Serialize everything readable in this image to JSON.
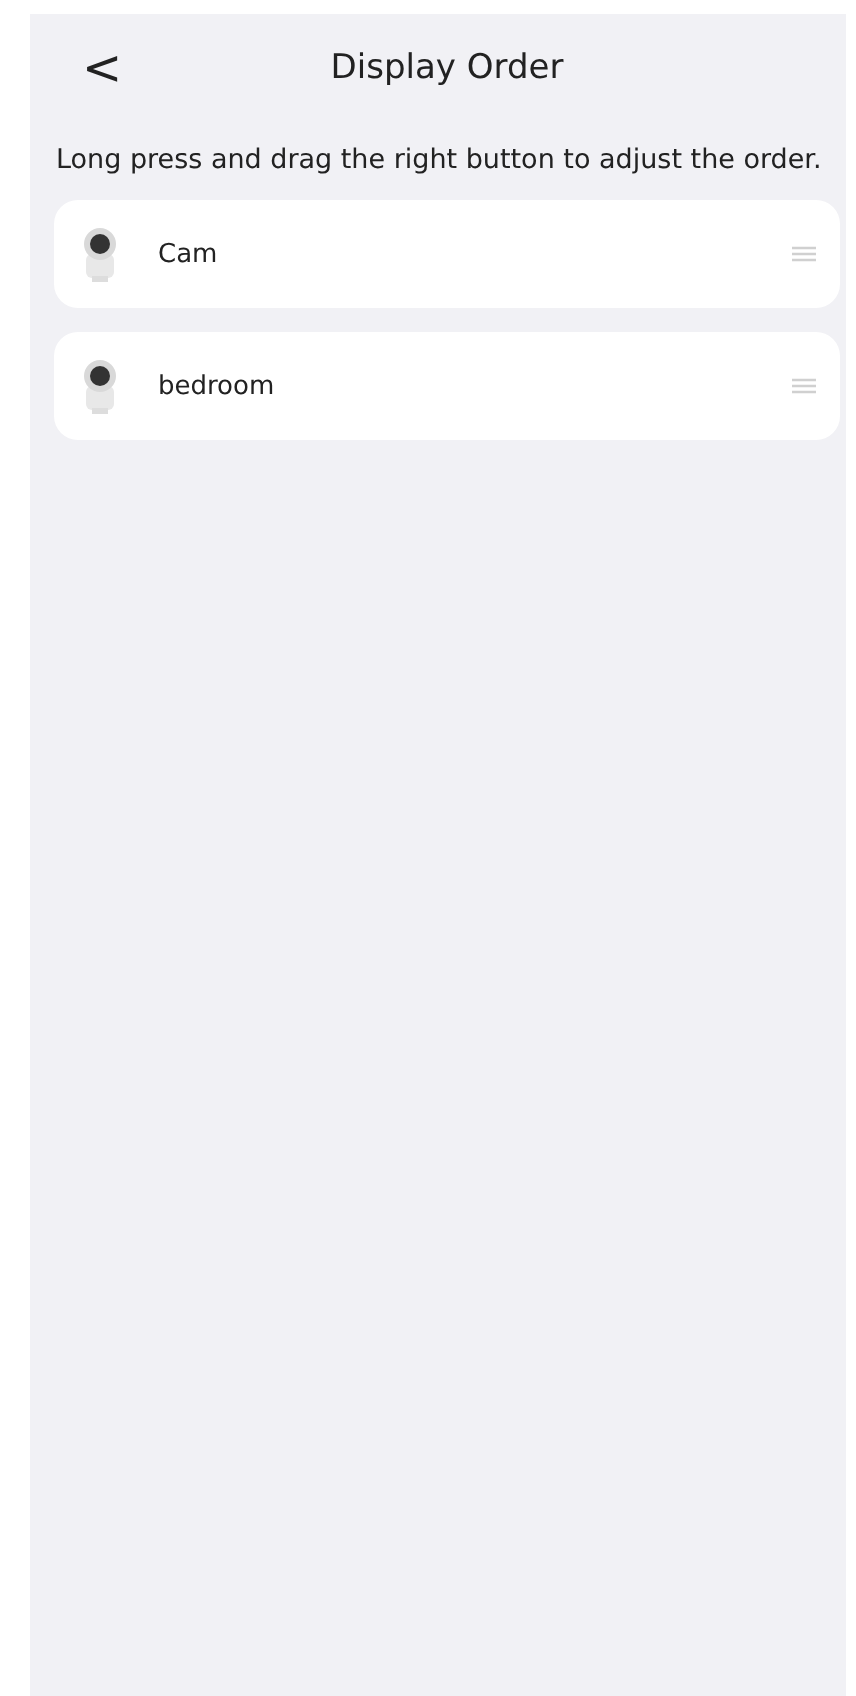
{
  "header": {
    "back_icon": "<",
    "title": "Display Order"
  },
  "hint": "Long press and drag the right button to adjust the order.",
  "devices": [
    {
      "name": "Cam"
    },
    {
      "name": "bedroom"
    }
  ]
}
